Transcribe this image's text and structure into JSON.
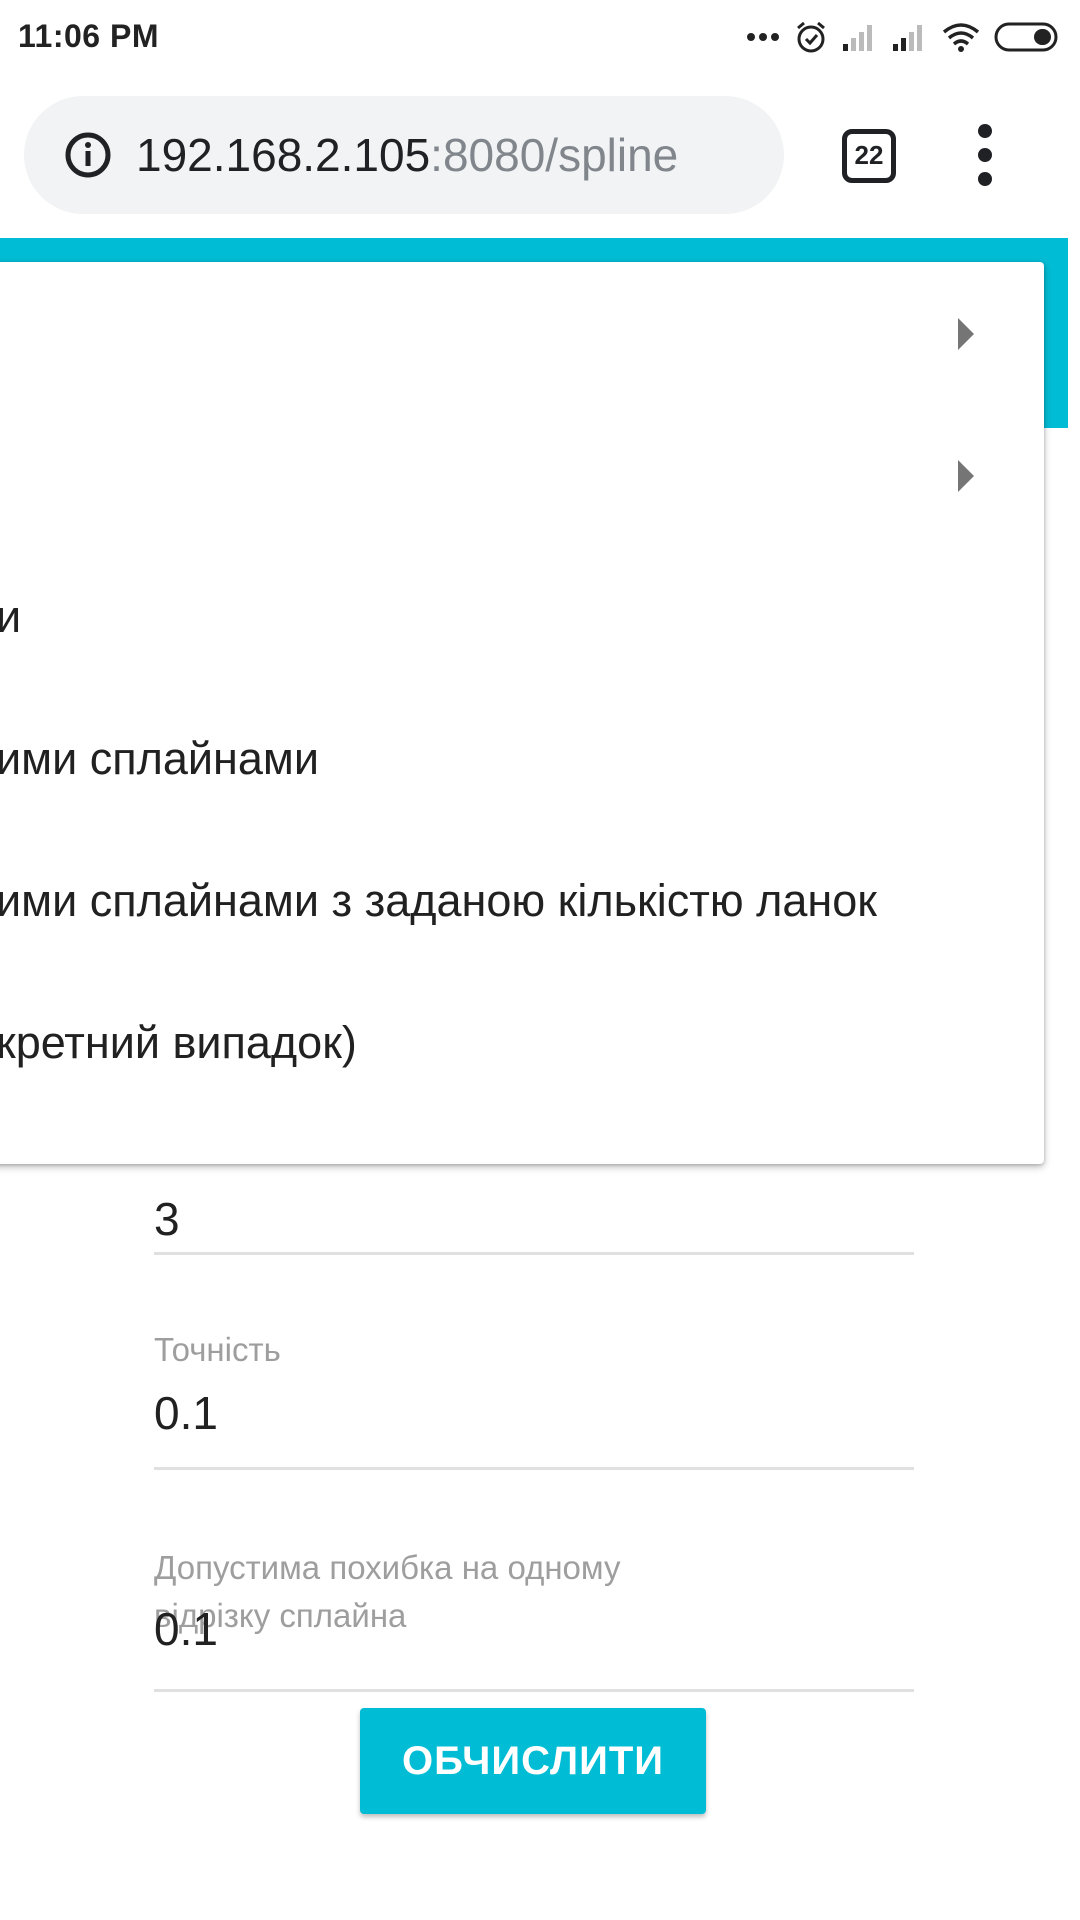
{
  "status_bar": {
    "time": "11:06 PM",
    "icons": [
      "more-dots-icon",
      "alarm-icon",
      "signal-icon",
      "signal-icon",
      "wifi-icon",
      "battery-icon"
    ]
  },
  "browser": {
    "url_host": "192.168.2.105",
    "url_rest": ":8080/spline",
    "tab_count": "22"
  },
  "menu": {
    "items": [
      {
        "label": "",
        "has_submenu": true
      },
      {
        "label": "",
        "has_submenu": true
      },
      {
        "label": "и",
        "has_submenu": false
      },
      {
        "label": "ими сплайнами",
        "has_submenu": false
      },
      {
        "label": "ими сплайнами з заданою кількістю ланок",
        "has_submenu": false
      },
      {
        "label": "кретний випадок)",
        "has_submenu": false
      }
    ]
  },
  "form": {
    "field_1": {
      "label": "",
      "value": "3"
    },
    "field_2": {
      "label": "Точність",
      "value": "0.1"
    },
    "field_3": {
      "label_line1": "Допустима похибка на одному",
      "label_line2": "відрізку сплайна",
      "value": "0.1"
    },
    "submit_label": "ОБЧИСЛИТИ"
  },
  "colors": {
    "accent": "#00bcd4",
    "omnibox_bg": "#f1f3f4",
    "label_gray": "#9e9e9e"
  }
}
